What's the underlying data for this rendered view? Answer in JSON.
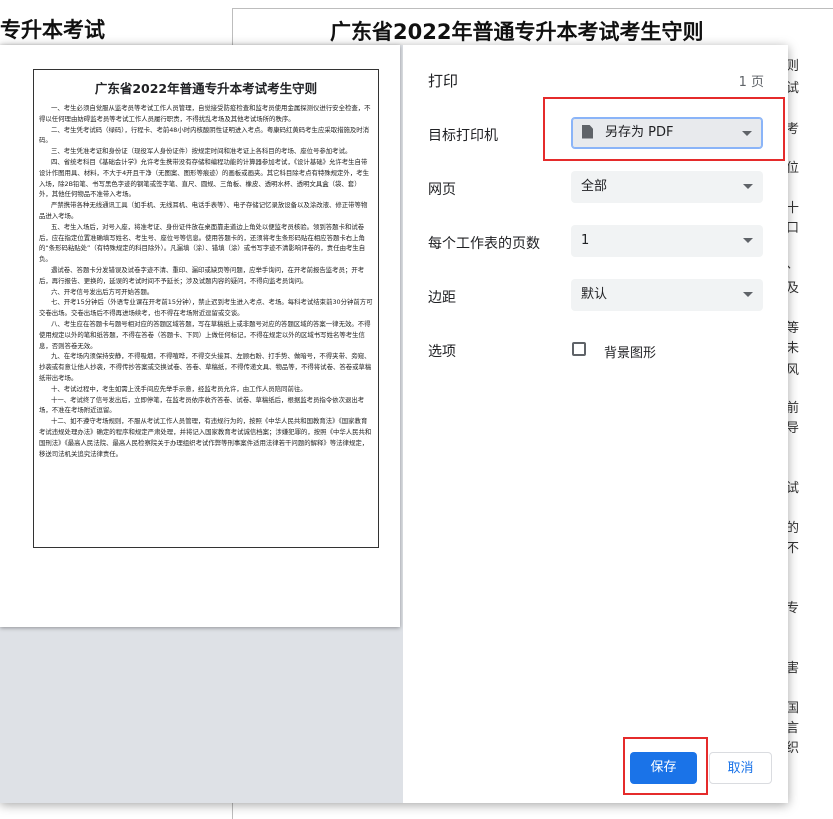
{
  "background": {
    "left_title": "专升本考试",
    "doc_title": "广东省2022年普通专升本考试考生守则",
    "right_edge_chars": [
      "则",
      "试",
      "考",
      "位",
      "十",
      "口",
      "、",
      "及",
      "等",
      "未",
      "风",
      "前",
      "导",
      "试",
      "的",
      "不",
      "专",
      "害",
      "国",
      "言",
      "织"
    ]
  },
  "dialog": {
    "header": {
      "title": "打印",
      "page_count": "1 页"
    },
    "destination": {
      "label": "目标打印机",
      "value": "另存为 PDF",
      "icon": "pdf-file-icon"
    },
    "pages": {
      "label": "网页",
      "value": "全部"
    },
    "pages_per_sheet": {
      "label": "每个工作表的页数",
      "value": "1"
    },
    "margins": {
      "label": "边距",
      "value": "默认"
    },
    "options": {
      "label": "选项",
      "checkbox_label": "背景图形",
      "checked": false
    },
    "buttons": {
      "save": "保存",
      "cancel": "取消"
    },
    "highlight_color": "#e52b2b",
    "accent_color": "#1a73e8"
  },
  "preview": {
    "title": "广东省2022年普通专升本考试考生守则",
    "paragraphs": [
      "一、考生必须自觉服从监考员等考试工作人员管理，自觉接受防疫检查和监考员使用金属探测仪进行安全检查，不得以任何理由妨碍监考员等考试工作人员履行职责，不得扰乱考场及其他考试场所的秩序。",
      "二、考生凭考试码（绿码），行程卡、考前48小时内核酸阴性证明进入考点。粤康码红黄码考生应采取措施及时消码。",
      "三、考生凭准考证和身份证（现役军人身份证件）按规定时间和准考证上各科目的考场、座位号参加考试。",
      "四、省统考科目《基础会计学》允许考生携带没有存储和编程功能的计算器参加考试，《设计基础》允许考生自带设计作图用具、材料，不大于4开且干净（无图案、图形等痕迹）的画板或画夹。其它科目除考点有特殊规定外，考生入场，除2B铅笔、书写黑色字迹的钢笔或签字笔、直尺、圆规、三角板、橡皮、透明水杯、透明文具盒（袋、套）外，其他任何物品不准带入考场。",
      "严禁携带各种无线通讯工具（如手机、无线耳机、电话手表等）、电子存储记忆录放设备以及涂改液、修正带等物品进入考场。",
      "五、考生入场后，对号入座，将准考证、身份证件放在桌面靠走道边上角处以便监考员核验。领到答题卡和试卷后，应在指定位置准确填写姓名、考生号、座位号等信息。使用答题卡的，还须将考生条形码贴在相应答题卡右上角的“条形码粘贴处”（有特殊规定的科目除外）。凡漏填（涂）、错填（涂）或书写字迹不清影响评卷的，责任由考生自负。",
      "遇试卷、答题卡分发错误及试卷字迹不清、重印、漏印或缺页等问题，应举手询问，在开考前报告监考员；开考后，再行报告、更换的，延误的考试时间不予延长；涉及试题内容的疑问，不得向监考员询问。",
      "六、开考信号发出后方可开始答题。",
      "七、开考15分钟后（外语专业课在开考前15分钟），禁止迟到考生进入考点、考场。每科考试结束前30分钟前方可交卷出场。交卷出场后不得再进场续考，也不得在考场附近逗留或交谈。",
      "八、考生应在答题卡与题号相对应的答题区域答题，写在草稿纸上或非题号对应的答题区域的答案一律无效。不得使用规定以外的笔和纸答题，不得在答卷（答题卡、下同）上做任何标记，不得在规定以外的区域书写姓名等考生信息，否则答卷无效。",
      "九、在考场内须保持安静，不得吸烟，不得喧哗，不得交头接耳、左顾右盼、打手势、做暗号，不得夹带、旁窥、抄袭或有意让他人抄袭，不得传抄答案或交换试卷、答卷、草稿纸，不得传递文具、物品等，不得将试卷、答卷或草稿纸带出考场。",
      "十、考试过程中，考生如需上洗手间应先举手示意，经监考员允许，由工作人员陪同前往。",
      "十一、考试终了信号发出后，立即停笔，在监考员依序收齐答卷、试卷、草稿纸后，根据监考员指令依次退出考场，不准在考场附近逗留。",
      "十二、如不遵守考场规则，不服从考试工作人员管理，有违规行为的，按照《中华人民共和国教育法》《国家教育考试违规处理办法》确定的程序和规定严肃处理，并将记入国家教育考试诚信档案；涉嫌犯罪的，按照《中华人民共和国刑法》《最高人民法院、最高人民检察院关于办理组织考试作弊等刑事案件适用法律若干问题的解释》等法律规定，移送司法机关追究法律责任。"
    ]
  }
}
